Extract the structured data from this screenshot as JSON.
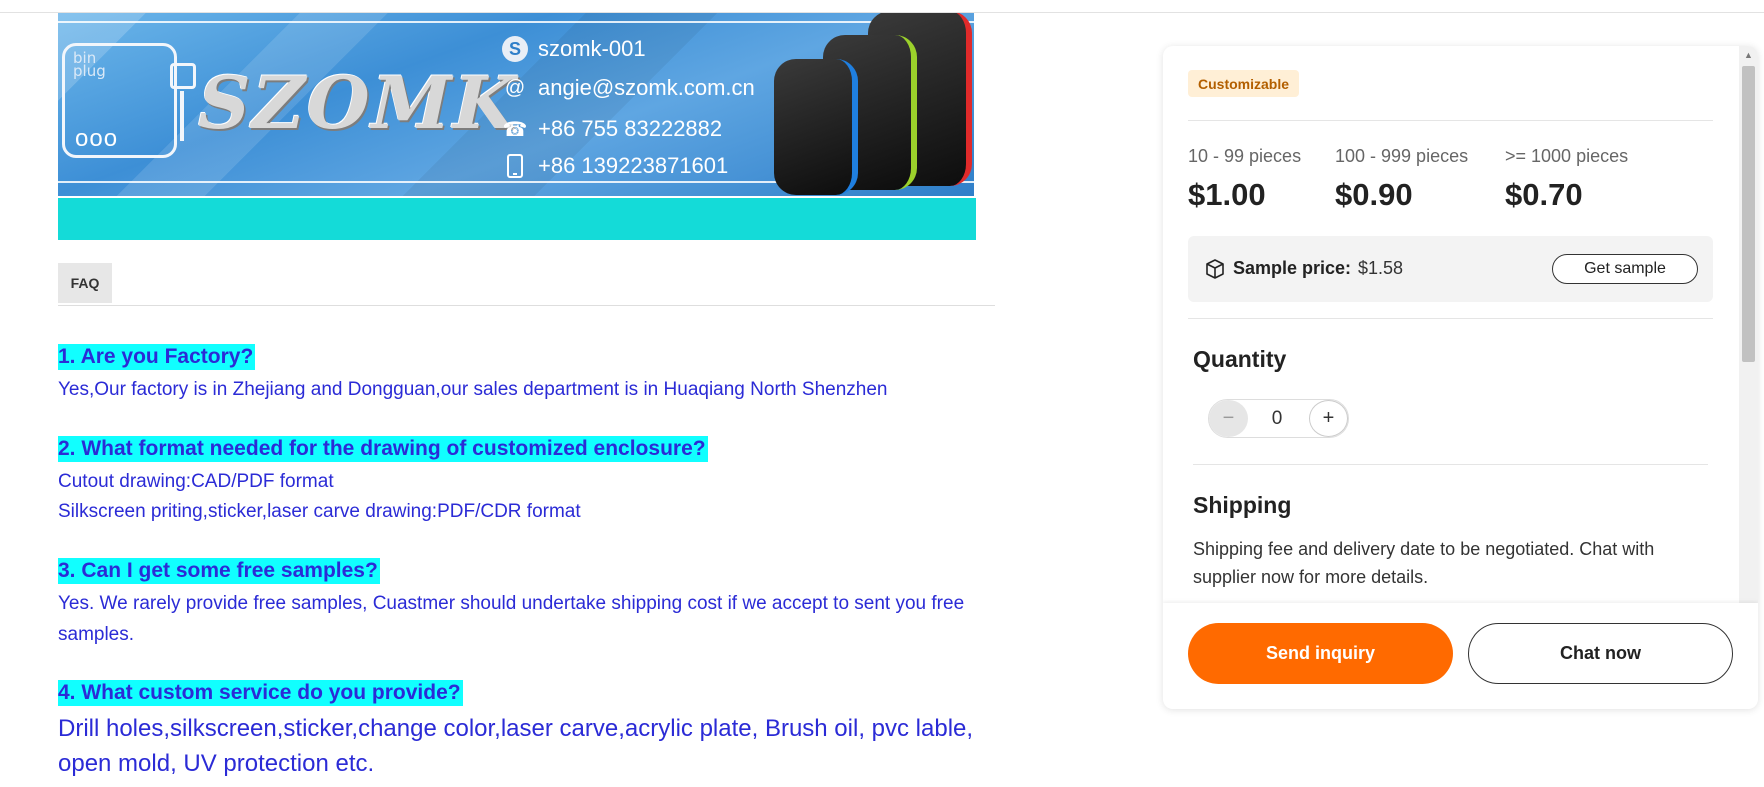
{
  "banner": {
    "brand": "SZOMK",
    "logo_text": "bin\nplug",
    "logo_dots": "ooo",
    "contacts": [
      {
        "icon": "skype-icon",
        "text": "szomk-001"
      },
      {
        "icon": "at-sign-icon",
        "text": "angie@szomk.com.cn"
      },
      {
        "icon": "phone-icon",
        "text": "+86 755 83222882"
      },
      {
        "icon": "mobile-icon",
        "text": "+86 13922387160​1"
      }
    ],
    "device_accents": [
      "#1f7fe0",
      "#9bd12b",
      "#e02a2a"
    ]
  },
  "faq": {
    "tab_label": "FAQ",
    "items": [
      {
        "q": "1. Are you Factory?",
        "a": [
          "Yes,Our factory is in Zhejiang and Dongguan,our sales department is in Huaqiang North Shenzhen"
        ]
      },
      {
        "q": "2. What format needed for the drawing of customized enclosure?",
        "a": [
          "Cutout drawing:CAD/PDF format",
          "Silkscreen priting,sticker,laser carve drawing:PDF/CDR format"
        ]
      },
      {
        "q": "3. Can I get some free samples?",
        "a": [
          "Yes. We rarely provide free samples, Cuastmer should undertake shipping cost if we accept to sent you free samples."
        ]
      },
      {
        "q": "4. What custom service do you provide?",
        "a": [
          "Drill holes,silkscreen,sticker,change color,laser carve,acrylic plate, Brush oil, pvc lable, open mold, UV protection etc."
        ]
      }
    ]
  },
  "panel": {
    "badge": "Customizable",
    "tiers": [
      {
        "range": "10 - 99 pieces",
        "price": "$1.00"
      },
      {
        "range": "100 - 999 pieces",
        "price": "$0.90"
      },
      {
        "range": ">= 1000 pieces",
        "price": "$0.70"
      }
    ],
    "sample": {
      "label": "Sample price:",
      "value": "$1.58",
      "button": "Get sample"
    },
    "quantity": {
      "title": "Quantity",
      "minus": "−",
      "value": "0",
      "plus": "+"
    },
    "shipping": {
      "title": "Shipping",
      "text": "Shipping fee and delivery date to be negotiated. Chat with supplier now for more details."
    },
    "actions": {
      "inquiry": "Send inquiry",
      "chat": "Chat now"
    },
    "colors": {
      "accent": "#ff6a00",
      "badge_bg": "#ffefd6",
      "badge_text": "#b35f00"
    }
  }
}
